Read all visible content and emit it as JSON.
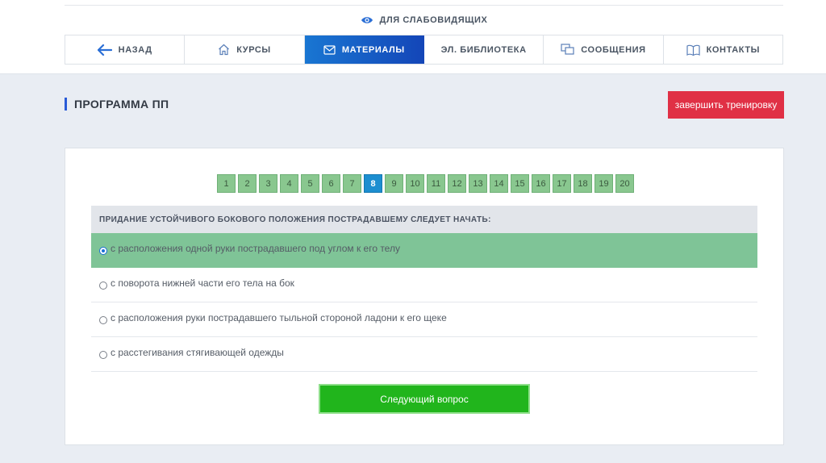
{
  "accessibility": {
    "label": "ДЛЯ СЛАБОВИДЯЩИХ",
    "icon": "eye-icon"
  },
  "nav": {
    "items": [
      {
        "label": "НАЗАД",
        "icon": "arrow-left-icon"
      },
      {
        "label": "КУРСЫ",
        "icon": "home-icon"
      },
      {
        "label": "МАТЕРИАЛЫ",
        "icon": "mail-icon",
        "active": true
      },
      {
        "label": "ЭЛ. БИБЛИОТЕКА"
      },
      {
        "label": "СООБЩЕНИЯ",
        "icon": "messages-icon"
      },
      {
        "label": "КОНТАКТЫ",
        "icon": "book-icon"
      }
    ]
  },
  "page": {
    "title": "ПРОГРАММА ПП",
    "finish_label": "завершить тренировку"
  },
  "pager": {
    "pages": [
      "1",
      "2",
      "3",
      "4",
      "5",
      "6",
      "7",
      "8",
      "9",
      "10",
      "11",
      "12",
      "13",
      "14",
      "15",
      "16",
      "17",
      "18",
      "19",
      "20"
    ],
    "current": "8"
  },
  "question": {
    "text": "ПРИДАНИЕ УСТОЙЧИВОГО БОКОВОГО ПОЛОЖЕНИЯ ПОСТРАДАВШЕМУ СЛЕДУЕТ НАЧАТЬ:",
    "answers": [
      "с расположения одной руки пострадавшего под углом к его телу",
      "с поворота нижней части его тела на бок",
      "с расположения руки пострадавшего тыльной стороной ладони к его щеке",
      "с расстегивания стягивающей одежды"
    ],
    "selected_index": 0
  },
  "next_label": "Следующий вопрос",
  "colors": {
    "accent": "#1976d2",
    "danger": "#e03045",
    "success": "#21b51c",
    "selected_row": "#7fc497",
    "page_btn": "#89c78f",
    "page_current": "#1c8ed0"
  }
}
